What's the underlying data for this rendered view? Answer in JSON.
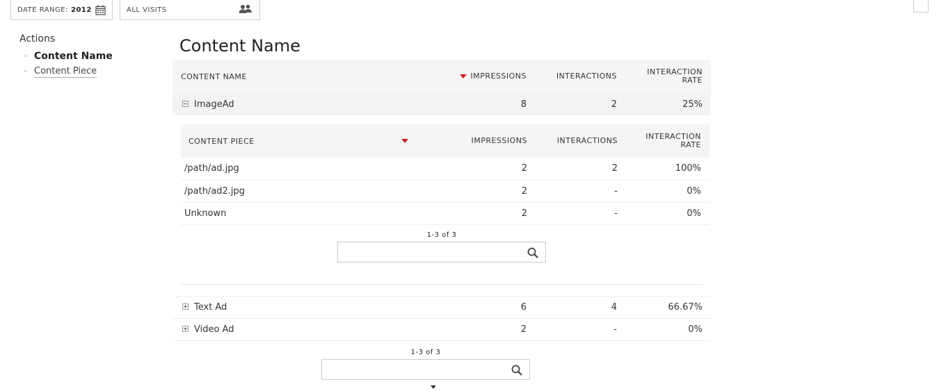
{
  "toolbar": {
    "date_range_label": "DATE RANGE:",
    "date_range_value": "2012",
    "segment_label": "ALL VISITS"
  },
  "sidebar": {
    "category": "Actions",
    "items": [
      {
        "label": "Content Name",
        "active": true
      },
      {
        "label": "Content Piece",
        "active": false
      }
    ]
  },
  "main": {
    "title": "Content Name",
    "columns": {
      "name": "CONTENT NAME",
      "impressions": "IMPRESSIONS",
      "interactions": "INTERACTIONS",
      "rate_line1": "INTERACTION",
      "rate_line2": "RATE"
    },
    "rows": [
      {
        "name": "ImageAd",
        "impressions": "8",
        "interactions": "2",
        "rate": "25%"
      },
      {
        "name": "Text Ad",
        "impressions": "6",
        "interactions": "4",
        "rate": "66.67%"
      },
      {
        "name": "Video Ad",
        "impressions": "2",
        "interactions": "-",
        "rate": "0%"
      }
    ],
    "pager": "1-3 of 3",
    "search_value": ""
  },
  "subtable": {
    "columns": {
      "name": "CONTENT PIECE",
      "impressions": "IMPRESSIONS",
      "interactions": "INTERACTIONS",
      "rate_line1": "INTERACTION",
      "rate_line2": "RATE"
    },
    "rows": [
      {
        "name": "/path/ad.jpg",
        "impressions": "2",
        "interactions": "2",
        "rate": "100%"
      },
      {
        "name": "/path/ad2.jpg",
        "impressions": "2",
        "interactions": "-",
        "rate": "0%"
      },
      {
        "name": "Unknown",
        "impressions": "2",
        "interactions": "-",
        "rate": "0%"
      }
    ],
    "pager": "1-3 of 3",
    "search_value": ""
  },
  "colors": {
    "sort_arrow": "#cc2222",
    "header_bg": "#f5f5f5"
  }
}
